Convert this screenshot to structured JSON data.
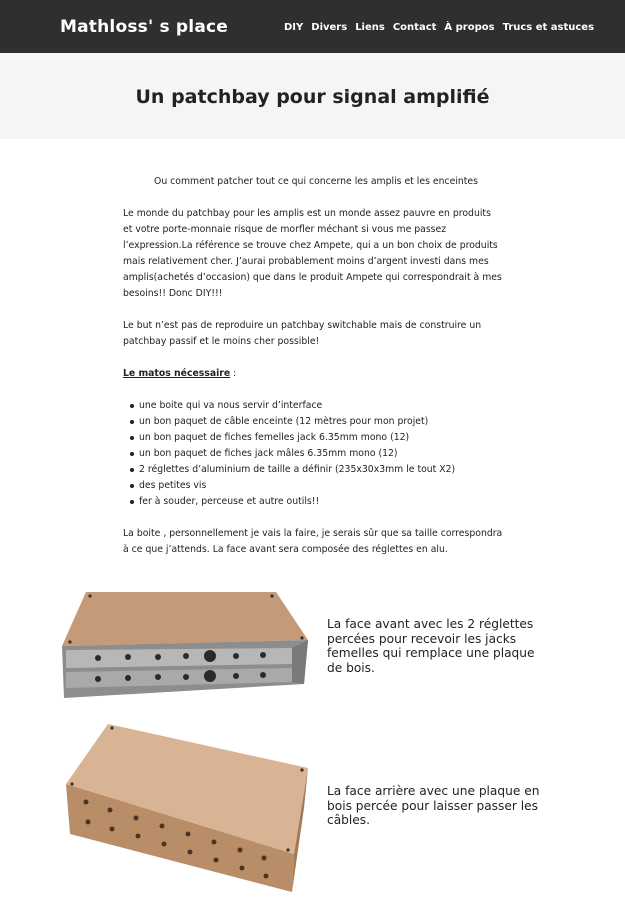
{
  "header": {
    "site_title": "Mathloss' s place",
    "nav": [
      "DIY",
      "Divers",
      "Liens",
      "Contact",
      "À propos",
      "Trucs et astuces"
    ]
  },
  "page": {
    "title": "Un patchbay pour signal amplifié"
  },
  "article": {
    "subtitle": "Ou comment patcher tout ce qui concerne les amplis et les enceintes",
    "para1": "Le monde du patchbay pour les amplis est un monde assez pauvre en produits et votre porte-monnaie risque de morfler méchant si vous me passez l’expression.La référence se trouve chez Ampete, qui a un bon choix de produits mais relativement cher. J’aurai probablement moins d’argent investi dans mes amplis(achetés d’occasion) que dans le produit Ampete qui correspondrait à mes besoins!! Donc DIY!!!",
    "para2": "Le but n’est pas de reproduire un patchbay switchable mais de construire un patchbay passif et le moins cher possible!",
    "matos_heading": "Le matos nécessaire",
    "matos_suffix": " :",
    "matos_items": [
      "une boite qui va nous servir d’interface",
      "un bon paquet de câble enceinte (12 mètres pour mon projet)",
      "un bon paquet de fiches femelles jack 6.35mm mono (12)",
      "un bon paquet de fiches jack mâles 6.35mm mono (12)",
      "2 réglettes d’aluminium de taille a définir (235x30x3mm le tout X2)",
      "des petites vis",
      "fer à souder, perceuse et autre outils!!"
    ],
    "para3": "La boite , personnellement je vais la faire, je serais sûr que sa taille correspondra à ce que j’attends. La face avant sera composée des réglettes en alu.",
    "caption1": "La face avant avec les 2 réglettes percées pour recevoir les jacks femelles qui remplace une plaque de bois.",
    "caption2": "La face arrière avec une plaque en bois percée pour laisser passer les câbles."
  },
  "colors": {
    "header_bg": "#2f2f2f",
    "banner_bg": "#f5f5f5",
    "wood": "#c49a78",
    "aluminium": "#a5a5a5"
  }
}
